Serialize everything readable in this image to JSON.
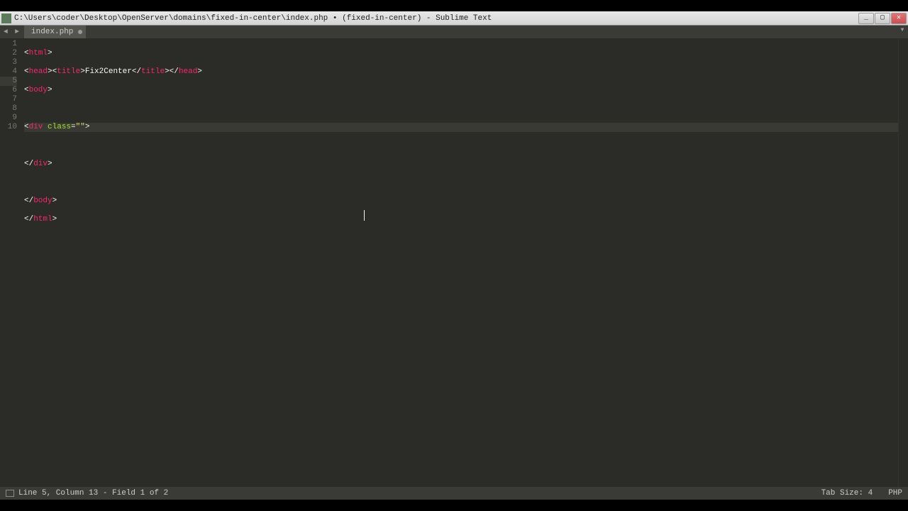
{
  "window": {
    "title": "C:\\Users\\coder\\Desktop\\OpenServer\\domains\\fixed-in-center\\index.php • (fixed-in-center) - Sublime Text"
  },
  "tab": {
    "label": "index.php",
    "dirty": true
  },
  "lines": [
    "1",
    "2",
    "3",
    "4",
    "5",
    "6",
    "7",
    "8",
    "9",
    "10"
  ],
  "active_line_index": 4,
  "code": {
    "l1": {
      "a": "<",
      "b": "html",
      "c": ">"
    },
    "l2": {
      "a": "<",
      "b": "head",
      "c": "><",
      "d": "title",
      "e": ">",
      "f": "Fix2Center",
      "g": "</",
      "h": "title",
      "i": "></",
      "j": "head",
      "k": ">"
    },
    "l3": {
      "a": "<",
      "b": "body",
      "c": ">"
    },
    "l5": {
      "a": "<",
      "b": "div",
      "c": " ",
      "d": "class",
      "e": "=",
      "f": "\"\"",
      "g": ">"
    },
    "l7": {
      "a": "</",
      "b": "div",
      "c": ">"
    },
    "l9": {
      "a": "</",
      "b": "body",
      "c": ">"
    },
    "l10": {
      "a": "</",
      "b": "html",
      "c": ">"
    }
  },
  "status": {
    "left": "Line 5, Column 13 - Field 1 of 2",
    "tabsize": "Tab Size: 4",
    "syntax": "PHP"
  },
  "win_controls": {
    "min": "_",
    "max": "▢",
    "close": "✕"
  },
  "nav": {
    "back": "◄",
    "fwd": "►",
    "drop": "▼"
  }
}
